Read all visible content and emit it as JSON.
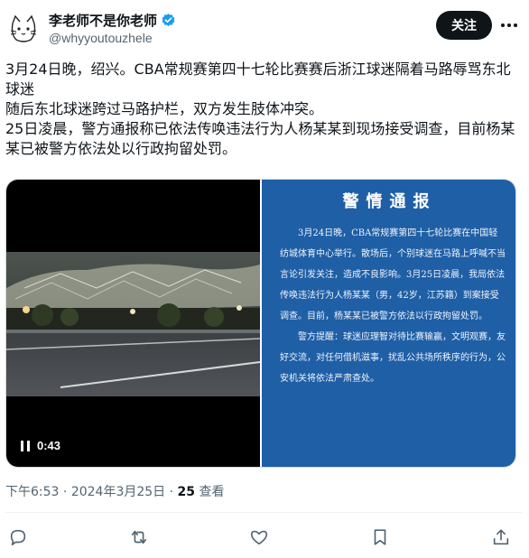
{
  "author": {
    "display_name": "李老师不是你老师",
    "handle": "@whyyoutouzhele",
    "verified": true
  },
  "header": {
    "follow_label": "关注"
  },
  "tweet": {
    "lines": [
      "3月24日晚，绍兴。CBA常规赛第四十七轮比赛赛后浙江球迷隔着马路辱骂东北球迷",
      "随后东北球迷跨过马路护栏，双方发生肢体冲突。",
      "25日凌晨，警方通报称已依法传唤违法行为人杨某某到现场接受调查，目前杨某某已被警方依法处以行政拘留处罚。"
    ]
  },
  "video": {
    "time": "0:43"
  },
  "notice": {
    "title": "警情通报",
    "paragraphs": [
      "3月24日晚，CBA常规赛第四十七轮比赛在中国轻纺城体育中心举行。散场后，个别球迷在马路上呼喊不当言论引发关注，造成不良影响。3月25日凌晨，我局依法传唤违法行为人杨某某（男，42岁，江苏籍）到案接受调查。目前，杨某某已被警方依法以行政拘留处罚。",
      "警方提醒：球迷应理智对待比赛输赢，文明观赛，友好交流，对任何借机滋事，扰乱公共场所秩序的行为，公安机关将依法严肃查处。"
    ]
  },
  "meta": {
    "time": "下午6:53",
    "date": "2024年3月25日",
    "separator": "·",
    "views_count": "25",
    "views_label": "查看"
  },
  "icons": {
    "reply": "reply-icon",
    "retweet": "retweet-icon",
    "like": "like-icon",
    "bookmark": "bookmark-icon",
    "share": "share-icon",
    "more": "more-icon",
    "verified": "verified-badge-icon",
    "pause": "pause-icon"
  },
  "colors": {
    "text": "#0f1419",
    "secondary": "#536471",
    "verified": "#1d9bf0",
    "notice_bg": "#1f5fa6",
    "follow_bg": "#0f1419"
  }
}
